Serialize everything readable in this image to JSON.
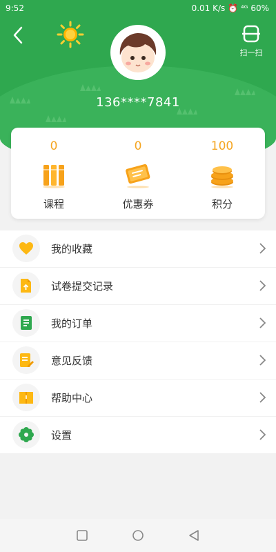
{
  "status_bar": {
    "time": "9:52",
    "right": "0.01 K/s ⏰ ⁴ᴳ 60%"
  },
  "header": {
    "phone": "136****7841",
    "scan_label": "扫一扫"
  },
  "stats": [
    {
      "value": "0",
      "label": "课程",
      "icon": "books-icon"
    },
    {
      "value": "0",
      "label": "优惠券",
      "icon": "coupon-icon"
    },
    {
      "value": "100",
      "label": "积分",
      "icon": "coins-icon"
    }
  ],
  "menu": [
    {
      "label": "我的收藏",
      "icon": "heart-icon"
    },
    {
      "label": "试卷提交记录",
      "icon": "document-upload-icon"
    },
    {
      "label": "我的订单",
      "icon": "order-book-icon"
    },
    {
      "label": "意见反馈",
      "icon": "feedback-edit-icon"
    },
    {
      "label": "帮助中心",
      "icon": "help-book-icon"
    },
    {
      "label": "设置",
      "icon": "gear-icon"
    }
  ],
  "colors": {
    "brand_green": "#2fa84f",
    "accent_orange": "#f5a623"
  }
}
